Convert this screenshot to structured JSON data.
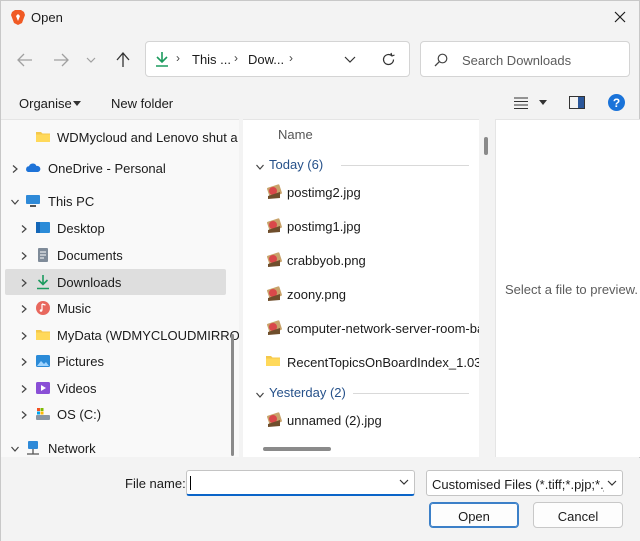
{
  "window": {
    "title": "Open",
    "close_icon": "close-icon"
  },
  "nav": {
    "back_icon": "arrow-left-icon",
    "forward_icon": "arrow-right-icon",
    "recent_icon": "chevron-down-icon",
    "up_icon": "arrow-up-icon",
    "breadcrumb": [
      "This ...",
      "Dow..."
    ],
    "refresh_icon": "refresh-icon",
    "search_placeholder": "Search Downloads"
  },
  "toolbar": {
    "organise": "Organise",
    "new_folder": "New folder"
  },
  "tree": [
    {
      "label": "WDMycloud and Lenovo shut a",
      "icon": "folder-icon",
      "indent": 1,
      "chevron": false
    },
    {
      "label": "OneDrive - Personal",
      "icon": "onedrive-icon",
      "indent": 0,
      "chevron": "right"
    },
    {
      "label": "This PC",
      "icon": "computer-icon",
      "indent": 0,
      "chevron": "down"
    },
    {
      "label": "Desktop",
      "icon": "desktop-icon",
      "indent": 1,
      "chevron": "right"
    },
    {
      "label": "Documents",
      "icon": "documents-icon",
      "indent": 1,
      "chevron": "right"
    },
    {
      "label": "Downloads",
      "icon": "downloads-icon",
      "indent": 1,
      "chevron": "right",
      "selected": true
    },
    {
      "label": "Music",
      "icon": "music-icon",
      "indent": 1,
      "chevron": "right"
    },
    {
      "label": "MyData (WDMYCLOUDMIRROF",
      "icon": "folder-icon",
      "indent": 1,
      "chevron": "right"
    },
    {
      "label": "Pictures",
      "icon": "pictures-icon",
      "indent": 1,
      "chevron": "right"
    },
    {
      "label": "Videos",
      "icon": "videos-icon",
      "indent": 1,
      "chevron": "right"
    },
    {
      "label": "OS (C:)",
      "icon": "drive-icon",
      "indent": 1,
      "chevron": "right"
    },
    {
      "label": "Network",
      "icon": "network-icon",
      "indent": 0,
      "chevron": "down"
    }
  ],
  "files": {
    "column": "Name",
    "groups": [
      {
        "label": "Today (6)",
        "items": [
          {
            "name": "postimg2.jpg",
            "icon": "image-file-icon"
          },
          {
            "name": "postimg1.jpg",
            "icon": "image-file-icon"
          },
          {
            "name": "crabbyob.png",
            "icon": "image-file-icon"
          },
          {
            "name": "zoony.png",
            "icon": "image-file-icon"
          },
          {
            "name": "computer-network-server-room-ba",
            "icon": "image-file-icon"
          },
          {
            "name": "RecentTopicsOnBoardIndex_1.03",
            "icon": "folder-icon"
          }
        ]
      },
      {
        "label": "Yesterday (2)",
        "items": [
          {
            "name": "unnamed (2).jpg",
            "icon": "image-file-icon"
          }
        ]
      }
    ]
  },
  "preview": {
    "message": "Select a file to preview."
  },
  "footer": {
    "file_name_label": "File name:",
    "file_name_value": "",
    "file_type": "Customised Files (*.tiff;*.pjp;*.jfif",
    "open": "Open",
    "cancel": "Cancel"
  },
  "colors": {
    "accent": "#0a64c8",
    "group_text": "#26518a",
    "selected_bg": "#dedede"
  }
}
